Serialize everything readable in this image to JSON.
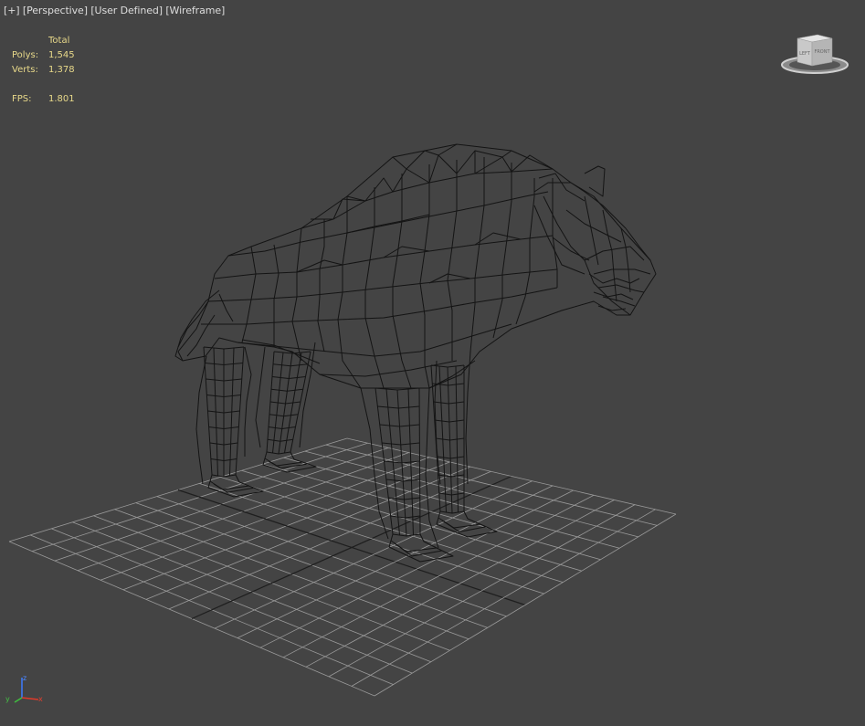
{
  "viewport": {
    "menu_label": "[+]",
    "view_label": "[Perspective]",
    "shading_label_1": "[User Defined]",
    "shading_label_2": "[Wireframe]"
  },
  "stats": {
    "header": "Total",
    "polys_label": "Polys:",
    "polys_value": "1,545",
    "verts_label": "Verts:",
    "verts_value": "1,378",
    "fps_label": "FPS:",
    "fps_value": "1.801"
  },
  "viewcube": {
    "left_face": "LEFT",
    "front_face": "FRONT"
  },
  "axis_gizmo": {
    "x": "x",
    "y": "y",
    "z": "z"
  },
  "colors": {
    "background": "#444444",
    "grid": "#9a9a9a",
    "grid_major": "#1e1e1e",
    "wireframe": "#141414",
    "stats_text": "#e8d98a",
    "label_text": "#dddddd"
  },
  "model": {
    "name": "hyena wireframe mesh"
  }
}
